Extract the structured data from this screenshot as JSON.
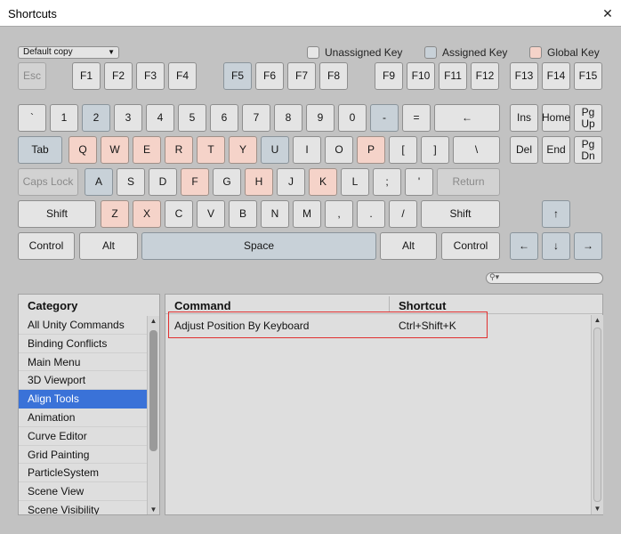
{
  "window": {
    "title": "Shortcuts",
    "close_glyph": "✕"
  },
  "profile": {
    "selected": "Default copy"
  },
  "legend": [
    {
      "label": "Unassigned Key",
      "color": "#e6e6e6"
    },
    {
      "label": "Assigned Key",
      "color": "#c8d1d8"
    },
    {
      "label": "Global Key",
      "color": "#f5d3c9"
    }
  ],
  "colors": {
    "assigned": "#c8d1d8",
    "global": "#f5d3c9",
    "selected": "#3a72d8",
    "highlight": "#e03030"
  },
  "keys": {
    "fn": [
      "Esc",
      "F1",
      "F2",
      "F3",
      "F4",
      "F5",
      "F6",
      "F7",
      "F8",
      "F9",
      "F10",
      "F11",
      "F12",
      "F13",
      "F14",
      "F15"
    ],
    "num": [
      "`",
      "1",
      "2",
      "3",
      "4",
      "5",
      "6",
      "7",
      "8",
      "9",
      "0",
      "-",
      "=",
      "←"
    ],
    "qwerty": [
      "Tab",
      "Q",
      "W",
      "E",
      "R",
      "T",
      "Y",
      "U",
      "I",
      "O",
      "P",
      "[",
      "]",
      "\\"
    ],
    "home": [
      "Caps Lock",
      "A",
      "S",
      "D",
      "F",
      "G",
      "H",
      "J",
      "K",
      "L",
      ";",
      "'",
      "Return"
    ],
    "shift": [
      "Shift",
      "Z",
      "X",
      "C",
      "V",
      "B",
      "N",
      "M",
      ",",
      ".",
      "/",
      "Shift"
    ],
    "bottom": [
      "Control",
      "Alt",
      "Space",
      "Alt",
      "Control"
    ],
    "nav1": [
      "Ins",
      "Home",
      "Pg\nUp"
    ],
    "nav2": [
      "Del",
      "End",
      "Pg\nDn"
    ],
    "arrows": [
      "↑",
      "←",
      "↓",
      "→"
    ]
  },
  "categories": {
    "header": "Category",
    "items": [
      "All Unity Commands",
      "Binding Conflicts",
      "Main Menu",
      "3D Viewport",
      "Align Tools",
      "Animation",
      "Curve Editor",
      "Grid Painting",
      "ParticleSystem",
      "Scene View",
      "Scene Visibility"
    ],
    "selected_index": 4
  },
  "commands": {
    "headers": {
      "command": "Command",
      "shortcut": "Shortcut"
    },
    "rows": [
      {
        "command": "Adjust Position By Keyboard",
        "shortcut": "Ctrl+Shift+K"
      }
    ]
  }
}
